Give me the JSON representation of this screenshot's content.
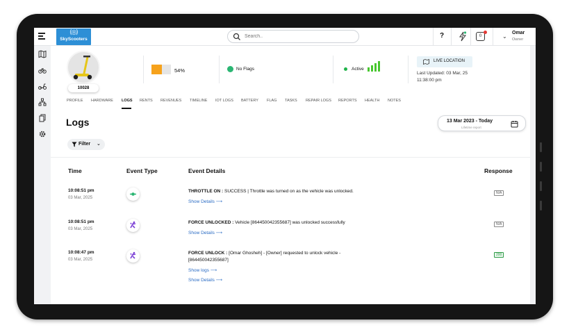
{
  "header": {
    "brand": "SkyScooters",
    "search_placeholder": "Search..",
    "help_label": "?",
    "notification_count": "0",
    "user": {
      "name": "Omar",
      "role": "Owner"
    }
  },
  "vehicle": {
    "id": "10028",
    "battery_percent": "54%",
    "battery_level": 0.54,
    "flags": "No Flags",
    "status": "Active",
    "live_location_label": "LIVE LOCATION",
    "last_updated": "Last Updated: 03 Mar, 25 11:38:00 pm"
  },
  "tabs": [
    "PROFILE",
    "HARDWARE",
    "LOGS",
    "RENTS",
    "REVENUES",
    "TIMELINE",
    "IOT LOGS",
    "BATTERY",
    "FLAG",
    "TASKS",
    "REPAIR LOGS",
    "REPORTS",
    "HEALTH",
    "NOTES"
  ],
  "active_tab": "LOGS",
  "page": {
    "title": "Logs",
    "date_range": "13 Mar 2023 - Today",
    "date_sub": "Lifetime report",
    "filter_label": "Filter"
  },
  "table": {
    "headers": {
      "time": "Time",
      "event_type": "Event Type",
      "details": "Event Details",
      "response": "Response"
    },
    "rows": [
      {
        "time": "10:08:51 pm",
        "date": "03 Mar, 2025",
        "event_icon": "throttle-icon",
        "title": "THROTTLE ON :",
        "text": " SUCCESS | Throttle was turned on as the vehicle was unlocked.",
        "link1": "Show Details",
        "response": "N/A"
      },
      {
        "time": "10:08:51 pm",
        "date": "03 Mar, 2025",
        "event_icon": "force-unlock-icon",
        "title": "FORCE UNLOCKED :",
        "text": " Vehicle [864450042355687] was unlocked successfully",
        "link1": "Show Details",
        "response": "N/A"
      },
      {
        "time": "10:08:47 pm",
        "date": "03 Mar, 2025",
        "event_icon": "force-unlock-icon",
        "title": "FORCE UNLOCK :",
        "text": " [Omar Ghosheh] - [Owner] requested to unlock vehicle - [864450042355687]",
        "link1": "Show logs",
        "link2": "Show Details",
        "response": "200"
      }
    ]
  },
  "colors": {
    "brand": "#2d8fd6",
    "battery": "#f6a21c",
    "active": "#20b34a",
    "link": "#2b6cc4",
    "ok": "#2e9b46"
  }
}
